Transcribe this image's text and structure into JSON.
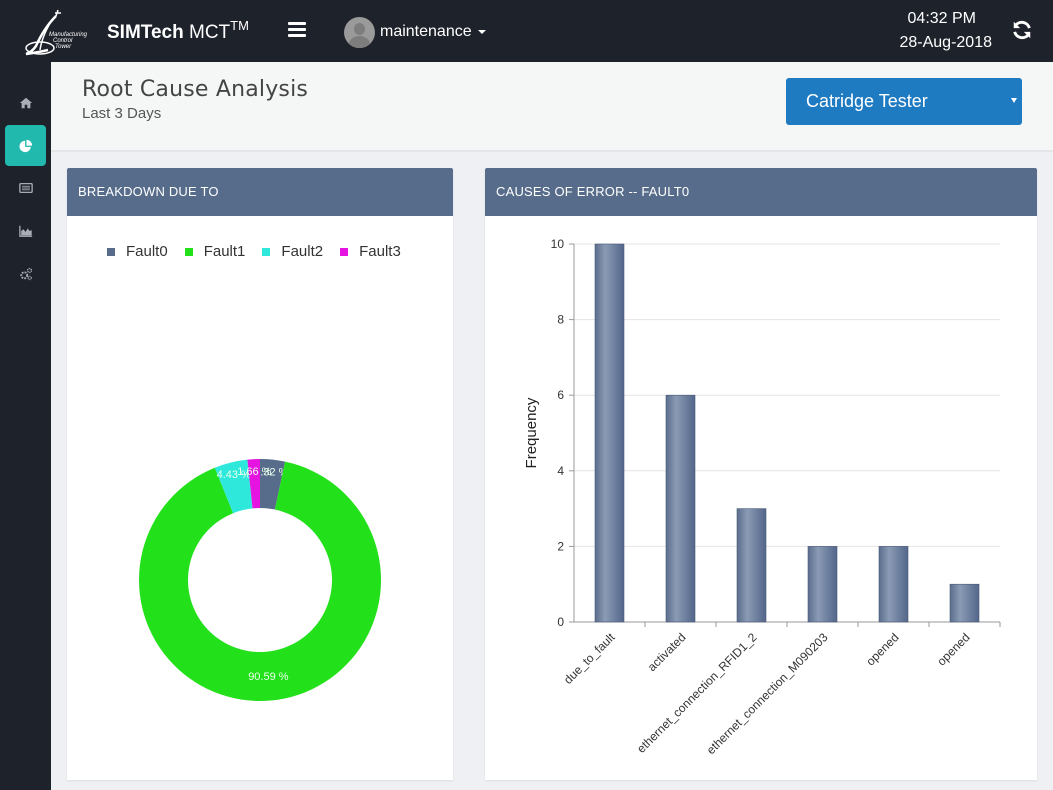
{
  "topbar": {
    "brand_bold": "SIMTech",
    "brand_rest": " MCT",
    "brand_sup": "TM",
    "logo_text": "Manufacturing Control Tower",
    "username": "maintenance",
    "time": "04:32 PM",
    "date": "28-Aug-2018"
  },
  "sidebar": {
    "items": [
      {
        "icon": "home-icon",
        "active": false
      },
      {
        "icon": "pie-chart-icon",
        "active": true
      },
      {
        "icon": "list-icon",
        "active": false
      },
      {
        "icon": "area-chart-icon",
        "active": false
      },
      {
        "icon": "cogs-icon",
        "active": false
      }
    ]
  },
  "header": {
    "title": "Root Cause Analysis",
    "subtitle": "Last 3 Days",
    "machine_selected": "Catridge Tester"
  },
  "colors": {
    "accent_active": "#21b8ad",
    "panel_header": "#576c8a",
    "selector": "#1f7bc1",
    "bar": "#5d7090"
  },
  "chart_data": [
    {
      "type": "pie",
      "title": "BREAKDOWN DUE TO",
      "donut": true,
      "legend_position": "top",
      "slices": [
        {
          "label": "Fault0",
          "value": 3.32,
          "color": "#576b8a"
        },
        {
          "label": "Fault1",
          "value": 90.59,
          "color": "#22e01a"
        },
        {
          "label": "Fault2",
          "value": 4.43,
          "color": "#2ee8dc"
        },
        {
          "label": "Fault3",
          "value": 1.66,
          "color": "#e614e0"
        }
      ],
      "data_labels": [
        "3.32 %",
        "90.59 %",
        "4.43 %",
        "1.66 %"
      ]
    },
    {
      "type": "bar",
      "title": "CAUSES OF ERROR -- FAULT0",
      "categories": [
        "due_to_fault",
        "activated",
        "ethernet_connection_RFID1_2",
        "ethernet_connection_M090203",
        "opened",
        "opened"
      ],
      "values": [
        10,
        6,
        3,
        2,
        2,
        1
      ],
      "xlabel": "",
      "ylabel": "Frequency",
      "ylim": [
        0,
        10
      ],
      "yticks": [
        0,
        2,
        4,
        6,
        8,
        10
      ],
      "grid": true
    }
  ]
}
